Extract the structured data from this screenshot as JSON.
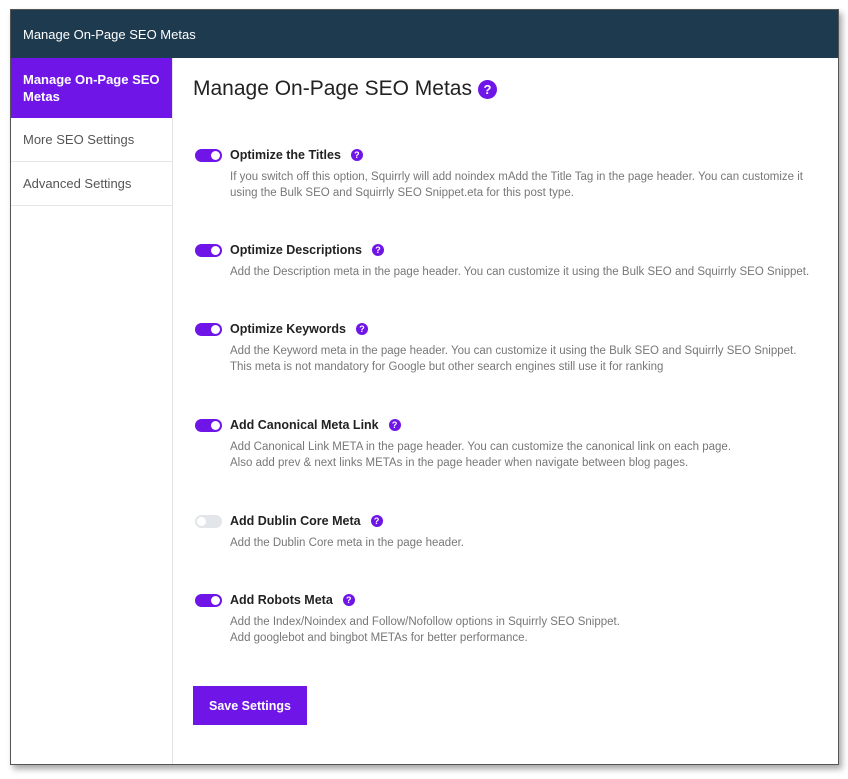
{
  "window": {
    "title": "Manage On-Page SEO Metas"
  },
  "sidebar": {
    "items": [
      {
        "label": "Manage On-Page SEO Metas",
        "active": true
      },
      {
        "label": "More SEO Settings",
        "active": false
      },
      {
        "label": "Advanced Settings",
        "active": false
      }
    ]
  },
  "main": {
    "title": "Manage On-Page SEO Metas",
    "help_glyph": "?",
    "options": [
      {
        "label": "Optimize the Titles",
        "enabled": true,
        "desc1": "If you switch off this option, Squirrly will add noindex mAdd the Title Tag in the page header. You can customize it",
        "desc2": "using the Bulk SEO and Squirrly SEO Snippet.eta for this post type."
      },
      {
        "label": "Optimize Descriptions",
        "enabled": true,
        "desc1": "Add the Description meta in the page header. You can customize it using the Bulk SEO and Squirrly SEO Snippet.",
        "desc2": ""
      },
      {
        "label": "Optimize Keywords",
        "enabled": true,
        "desc1": "Add the Keyword meta in the page header. You can customize it using the Bulk SEO and Squirrly SEO Snippet.",
        "desc2": "This meta is not mandatory for Google but other search engines still use it for ranking"
      },
      {
        "label": "Add Canonical Meta Link",
        "enabled": true,
        "desc1": "Add Canonical Link META in the page header. You can customize the canonical link on each page.",
        "desc2": "Also add prev & next links METAs in the page header when navigate between blog pages."
      },
      {
        "label": "Add Dublin Core Meta",
        "enabled": false,
        "desc1": "Add the Dublin Core meta in the page header.",
        "desc2": ""
      },
      {
        "label": "Add Robots Meta",
        "enabled": true,
        "desc1": "Add the Index/Noindex and Follow/Nofollow options in Squirrly SEO Snippet.",
        "desc2": "Add googlebot and bingbot METAs for better performance."
      }
    ],
    "save_label": "Save Settings"
  },
  "colors": {
    "accent": "#6f15e8",
    "topbar": "#1e3a4f",
    "toggle_off": "#e2e5ea"
  }
}
